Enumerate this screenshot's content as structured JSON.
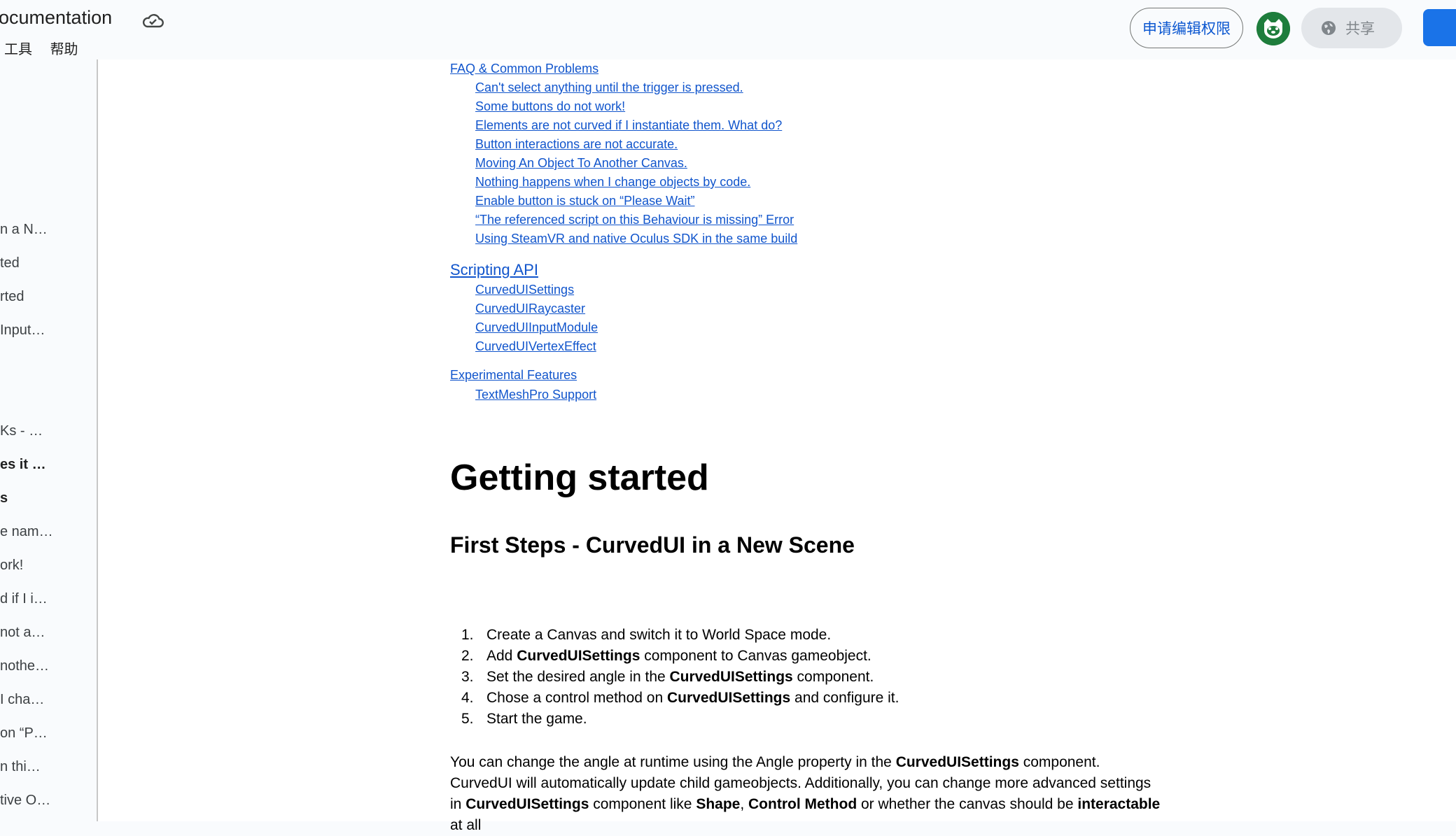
{
  "header": {
    "doc_title": "ocumentation",
    "menu": [
      "工具",
      "帮助"
    ],
    "request_edit_label": "申请编辑权限",
    "share_label": "共享",
    "accent_color": "#0b57d0",
    "avatar_color": "#1e7d3c",
    "primary_button_color": "#1a73e8",
    "icons": [
      "cloud-icon",
      "avatar-icon",
      "globe-icon"
    ]
  },
  "outline": {
    "items": [
      {
        "label": "n a N…",
        "bold": false
      },
      {
        "label": "ted",
        "bold": false
      },
      {
        "label": "rted",
        "bold": false
      },
      {
        "label": " Input…",
        "bold": false
      },
      {
        "label": "Ks - …",
        "bold": false
      },
      {
        "label": "es it …",
        "bold": true
      },
      {
        "label": "s",
        "bold": true
      },
      {
        "label": "e nam…",
        "bold": false
      },
      {
        "label": "ork!",
        "bold": false
      },
      {
        "label": "d if I i…",
        "bold": false
      },
      {
        "label": "not a…",
        "bold": false
      },
      {
        "label": "nothe…",
        "bold": false
      },
      {
        "label": " I cha…",
        "bold": false
      },
      {
        "label": "on “P…",
        "bold": false
      },
      {
        "label": "n thi…",
        "bold": false
      },
      {
        "label": "tive O…",
        "bold": false
      }
    ]
  },
  "toc": {
    "faq": {
      "title": "FAQ & Common Problems",
      "items": [
        "Can't select anything until the trigger is pressed.",
        "Some buttons do not work!",
        "Elements are not curved if I instantiate them. What do?",
        "Button interactions are not accurate.",
        "Moving An Object To Another Canvas.",
        "Nothing happens when I change objects by code.",
        "Enable button is stuck on “Please Wait”",
        "“The referenced script on this Behaviour is missing” Error",
        "Using SteamVR and native Oculus SDK in the same build"
      ]
    },
    "api": {
      "title": "Scripting API",
      "items": [
        "CurvedUISettings",
        "CurvedUIRaycaster",
        "CurvedUIInputModule",
        "CurvedUIVertexEffect"
      ]
    },
    "experimental": {
      "title": "Experimental Features",
      "items": [
        "TextMeshPro Support"
      ]
    },
    "link_color": "#1155cc"
  },
  "content": {
    "h1": "Getting started",
    "h2": "First Steps - CurvedUI in a New Scene",
    "steps": [
      {
        "num": "1.",
        "parts": [
          {
            "t": "Create a Canvas and switch it to World Space mode.",
            "b": false
          }
        ]
      },
      {
        "num": "2.",
        "parts": [
          {
            "t": "Add ",
            "b": false
          },
          {
            "t": "CurvedUISettings",
            "b": true
          },
          {
            "t": " component to Canvas gameobject.",
            "b": false
          }
        ]
      },
      {
        "num": "3.",
        "parts": [
          {
            "t": "Set the desired angle in the ",
            "b": false
          },
          {
            "t": "CurvedUISettings",
            "b": true
          },
          {
            "t": " component.",
            "b": false
          }
        ]
      },
      {
        "num": "4.",
        "parts": [
          {
            "t": "Chose a control method on ",
            "b": false
          },
          {
            "t": "CurvedUISettings",
            "b": true
          },
          {
            "t": " and configure it.",
            "b": false
          }
        ]
      },
      {
        "num": "5.",
        "parts": [
          {
            "t": "Start the game.",
            "b": false
          }
        ]
      }
    ],
    "paragraph": [
      {
        "t": "You can change the angle at runtime using the Angle property in the ",
        "b": false
      },
      {
        "t": "CurvedUISettings",
        "b": true
      },
      {
        "t": " component. CurvedUI will automatically update child gameobjects. Additionally, you can change more advanced settings in ",
        "b": false
      },
      {
        "t": "CurvedUISettings",
        "b": true
      },
      {
        "t": " component like ",
        "b": false
      },
      {
        "t": "Shape",
        "b": true
      },
      {
        "t": ", ",
        "b": false
      },
      {
        "t": "Control Method",
        "b": true
      },
      {
        "t": " or whether the canvas should be ",
        "b": false
      },
      {
        "t": "interactable",
        "b": true
      },
      {
        "t": " at all",
        "b": false
      }
    ]
  }
}
